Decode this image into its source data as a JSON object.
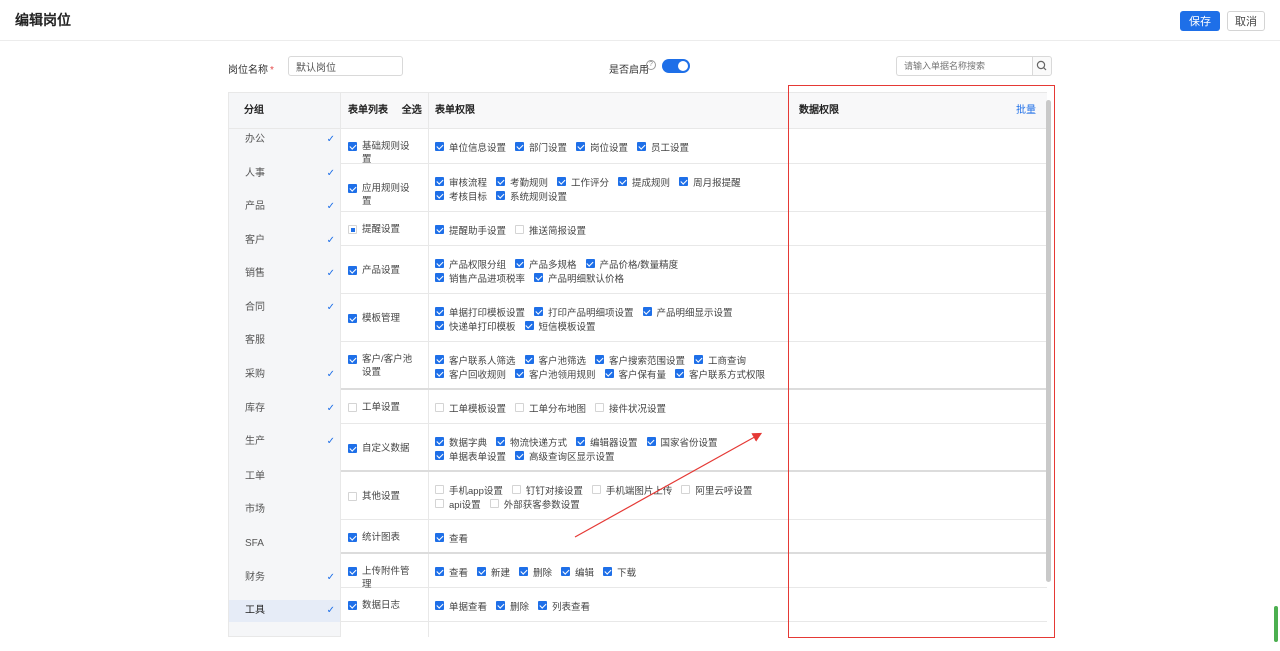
{
  "header": {
    "title": "编辑岗位",
    "save_label": "保存",
    "cancel_label": "取消"
  },
  "form": {
    "name_label": "岗位名称",
    "required_mark": "*",
    "name_value": "默认岗位",
    "enabled_label": "是否启用",
    "help_glyph": "?",
    "enabled": true,
    "search_placeholder": "请输入单据名称搜索",
    "search_icon": "search-icon"
  },
  "sidebar": {
    "header": "分组",
    "items": [
      {
        "label": "办公",
        "checked": true
      },
      {
        "label": "人事",
        "checked": true
      },
      {
        "label": "产品",
        "checked": true
      },
      {
        "label": "客户",
        "checked": true
      },
      {
        "label": "销售",
        "checked": true
      },
      {
        "label": "合同",
        "checked": true
      },
      {
        "label": "客服",
        "checked": false
      },
      {
        "label": "采购",
        "checked": true
      },
      {
        "label": "库存",
        "checked": true
      },
      {
        "label": "生产",
        "checked": true
      },
      {
        "label": "工单",
        "checked": false
      },
      {
        "label": "市场",
        "checked": false
      },
      {
        "label": "SFA",
        "checked": false
      },
      {
        "label": "财务",
        "checked": true
      },
      {
        "label": "工具",
        "checked": true,
        "active": true
      }
    ]
  },
  "table": {
    "col_list": "表单列表",
    "select_all": "全选",
    "col_perm": "表单权限",
    "col_data": "数据权限",
    "batch": "批量",
    "rows": [
      {
        "label": "基础规则设置",
        "state": "on",
        "perms": [
          {
            "label": "单位信息设置",
            "on": true
          },
          {
            "label": "部门设置",
            "on": true
          },
          {
            "label": "岗位设置",
            "on": true
          },
          {
            "label": "员工设置",
            "on": true
          }
        ]
      },
      {
        "label": "应用规则设置",
        "state": "on",
        "perms": [
          {
            "label": "审核流程",
            "on": true
          },
          {
            "label": "考勤规则",
            "on": true
          },
          {
            "label": "工作评分",
            "on": true
          },
          {
            "label": "提成规则",
            "on": true
          },
          {
            "label": "周月报提醒",
            "on": true
          },
          {
            "label": "考核目标",
            "on": true
          },
          {
            "label": "系统规则设置",
            "on": true
          }
        ]
      },
      {
        "label": "提醒设置",
        "state": "partial",
        "perms": [
          {
            "label": "提醒助手设置",
            "on": true
          },
          {
            "label": "推送简报设置",
            "on": false
          }
        ]
      },
      {
        "label": "产品设置",
        "state": "on",
        "perms": [
          {
            "label": "产品权限分组",
            "on": true
          },
          {
            "label": "产品多规格",
            "on": true
          },
          {
            "label": "产品价格/数量精度",
            "on": true
          },
          {
            "label": "销售产品进项税率",
            "on": true
          },
          {
            "label": "产品明细默认价格",
            "on": true
          }
        ]
      },
      {
        "label": "模板管理",
        "state": "on",
        "perms": [
          {
            "label": "单据打印模板设置",
            "on": true
          },
          {
            "label": "打印产品明细项设置",
            "on": true
          },
          {
            "label": "产品明细显示设置",
            "on": true
          },
          {
            "label": "快递单打印模板",
            "on": true
          },
          {
            "label": "短信模板设置",
            "on": true
          }
        ]
      },
      {
        "label": "客户/客户池设置",
        "state": "on",
        "perms": [
          {
            "label": "客户联系人筛选",
            "on": true
          },
          {
            "label": "客户池筛选",
            "on": true
          },
          {
            "label": "客户搜索范围设置",
            "on": true
          },
          {
            "label": "工商查询",
            "on": true
          },
          {
            "label": "客户回收规则",
            "on": true
          },
          {
            "label": "客户池领用规则",
            "on": true
          },
          {
            "label": "客户保有量",
            "on": true
          },
          {
            "label": "客户联系方式权限",
            "on": true
          }
        ]
      },
      {
        "label": "工单设置",
        "state": "off",
        "perms": [
          {
            "label": "工单模板设置",
            "on": false
          },
          {
            "label": "工单分布地图",
            "on": false
          },
          {
            "label": "接件状况设置",
            "on": false
          }
        ]
      },
      {
        "label": "自定义数据",
        "state": "on",
        "perms": [
          {
            "label": "数据字典",
            "on": true
          },
          {
            "label": "物流快递方式",
            "on": true
          },
          {
            "label": "编辑器设置",
            "on": true
          },
          {
            "label": "国家省份设置",
            "on": true
          },
          {
            "label": "单据表单设置",
            "on": true
          },
          {
            "label": "高级查询区显示设置",
            "on": true
          }
        ]
      },
      {
        "label": "其他设置",
        "state": "off",
        "perms": [
          {
            "label": "手机app设置",
            "on": false
          },
          {
            "label": "钉钉对接设置",
            "on": false
          },
          {
            "label": "手机端图片上传",
            "on": false
          },
          {
            "label": "阿里云呼设置",
            "on": false
          },
          {
            "label": "api设置",
            "on": false
          },
          {
            "label": "外部获客参数设置",
            "on": false
          }
        ]
      },
      {
        "label": "统计图表",
        "state": "on",
        "perms": [
          {
            "label": "查看",
            "on": true
          }
        ]
      },
      {
        "label": "上传附件管理",
        "state": "on",
        "perms": [
          {
            "label": "查看",
            "on": true
          },
          {
            "label": "新建",
            "on": true
          },
          {
            "label": "删除",
            "on": true
          },
          {
            "label": "编辑",
            "on": true
          },
          {
            "label": "下载",
            "on": true
          }
        ]
      },
      {
        "label": "数据日志",
        "state": "on",
        "perms": [
          {
            "label": "单据查看",
            "on": true
          },
          {
            "label": "删除",
            "on": true
          },
          {
            "label": "列表查看",
            "on": true
          }
        ]
      }
    ]
  },
  "colors": {
    "accent": "#1e6fe8",
    "annotation": "#e53935"
  }
}
